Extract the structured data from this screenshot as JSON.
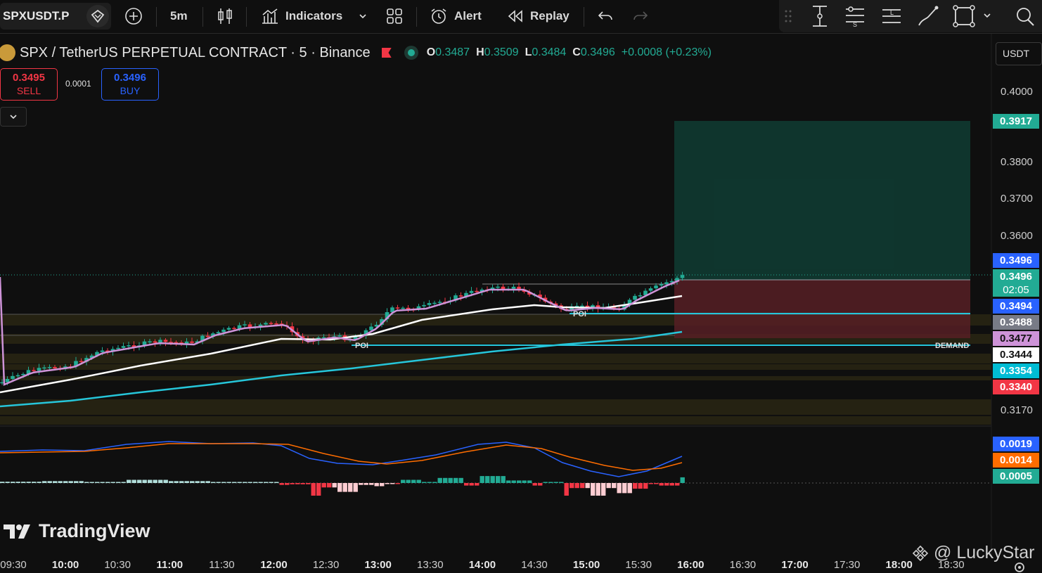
{
  "toolbar": {
    "symbol": "SPXUSDT.P",
    "interval": "5m",
    "indicators_label": "Indicators",
    "alert_label": "Alert",
    "replay_label": "Replay"
  },
  "legend": {
    "title": "SPX / TetherUS PERPETUAL CONTRACT · 5 · Binance",
    "open_key": "O",
    "open": "0.3487",
    "high_key": "H",
    "high": "0.3509",
    "low_key": "L",
    "low": "0.3484",
    "close_key": "C",
    "close": "0.3496",
    "change": "+0.0008 (+0.23%)"
  },
  "trade": {
    "sell_price": "0.3495",
    "sell_label": "SELL",
    "buy_price": "0.3496",
    "buy_label": "BUY",
    "spread": "0.0001"
  },
  "currency": "USDT",
  "price_axis": [
    "0.4000",
    "0.3800",
    "0.3700",
    "0.3600",
    "0.3170"
  ],
  "price_tags": [
    {
      "value": "0.3917",
      "color": "#22ab94"
    },
    {
      "value": "0.3496",
      "color": "#2962ff"
    },
    {
      "value": "0.3496",
      "color": "#22ab94"
    },
    {
      "value": "02:05",
      "color": "#22ab94"
    },
    {
      "value": "0.3494",
      "color": "#2962ff"
    },
    {
      "value": "0.3488",
      "color": "#787b86"
    },
    {
      "value": "0.3477",
      "color": "#ce93d8"
    },
    {
      "value": "0.3444",
      "color": "#ffffff"
    },
    {
      "value": "0.3354",
      "color": "#00bcd4"
    },
    {
      "value": "0.3340",
      "color": "#f23645"
    }
  ],
  "macd_tags": [
    {
      "value": "0.0019",
      "color": "#2962ff"
    },
    {
      "value": "0.0014",
      "color": "#ff6d00"
    },
    {
      "value": "0.0005",
      "color": "#22ab94"
    }
  ],
  "chart_labels": {
    "poi_1": "POI",
    "poi_2": "POI",
    "demand": "DEMAND"
  },
  "time_axis": [
    {
      "label": "09:30",
      "bold": false
    },
    {
      "label": "10:00",
      "bold": true
    },
    {
      "label": "10:30",
      "bold": false
    },
    {
      "label": "11:00",
      "bold": true
    },
    {
      "label": "11:30",
      "bold": false
    },
    {
      "label": "12:00",
      "bold": true
    },
    {
      "label": "12:30",
      "bold": false
    },
    {
      "label": "13:00",
      "bold": true
    },
    {
      "label": "13:30",
      "bold": false
    },
    {
      "label": "14:00",
      "bold": true
    },
    {
      "label": "14:30",
      "bold": false
    },
    {
      "label": "15:00",
      "bold": true
    },
    {
      "label": "15:30",
      "bold": false
    },
    {
      "label": "16:00",
      "bold": true
    },
    {
      "label": "16:30",
      "bold": false
    },
    {
      "label": "17:00",
      "bold": true
    },
    {
      "label": "17:30",
      "bold": false
    },
    {
      "label": "18:00",
      "bold": true
    },
    {
      "label": "18:30",
      "bold": false
    }
  ],
  "brand": "TradingView",
  "watermark": "@ LuckyStar",
  "colors": {
    "up": "#22ab94",
    "down": "#f23645",
    "ema_fast": "#ce93d8",
    "ema_mid": "#ffffff",
    "ema_slow": "#26c6da",
    "macd": "#2962ff",
    "signal": "#ff6d00"
  }
}
